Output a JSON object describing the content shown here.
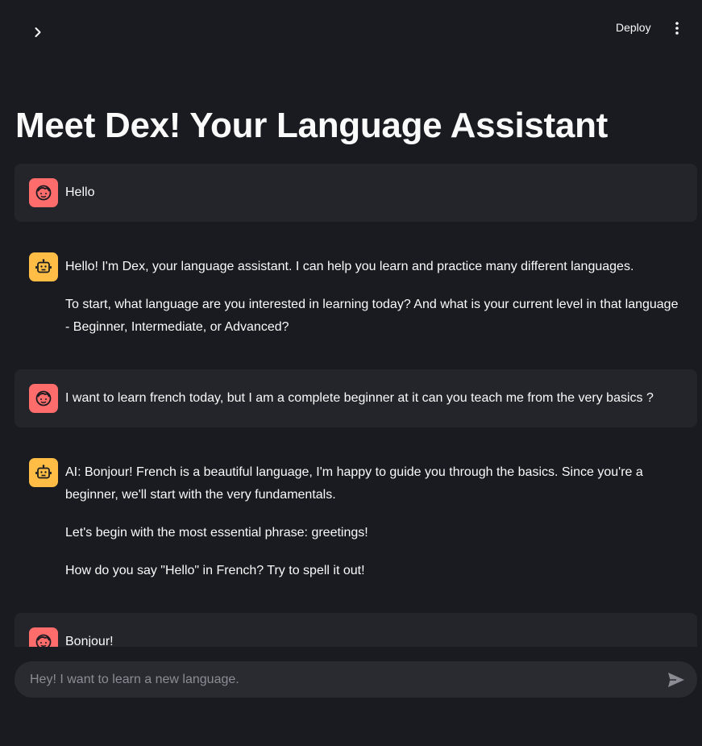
{
  "header": {
    "deploy_label": "Deploy"
  },
  "page": {
    "title": "Meet Dex! Your Language Assistant"
  },
  "messages": [
    {
      "role": "user",
      "paragraphs": [
        "Hello"
      ]
    },
    {
      "role": "assistant",
      "paragraphs": [
        "Hello! I'm Dex, your language assistant. I can help you learn and practice many different languages.",
        "To start, what language are you interested in learning today? And what is your current level in that language - Beginner, Intermediate, or Advanced?"
      ]
    },
    {
      "role": "user",
      "paragraphs": [
        "I want to learn french today, but I am a complete beginner at it can you teach me from the very basics ?"
      ]
    },
    {
      "role": "assistant",
      "paragraphs": [
        "AI: Bonjour! French is a beautiful language, I'm happy to guide you through the basics. Since you're a beginner, we'll start with the very fundamentals.",
        "Let's begin with the most essential phrase: greetings!",
        "How do you say \"Hello\" in French? Try to spell it out!"
      ]
    },
    {
      "role": "user",
      "paragraphs": [
        "Bonjour!"
      ]
    }
  ],
  "chat_input": {
    "placeholder": "Hey! I want to learn a new language."
  },
  "icons": {
    "sidebar_toggle": "chevron-right-icon",
    "menu": "vertical-dots-icon",
    "user_avatar": "face-icon",
    "assistant_avatar": "robot-icon",
    "send": "send-icon"
  },
  "colors": {
    "background": "#1a1b20",
    "user_message_bg": "#24252b",
    "user_avatar": "#ff6c6c",
    "assistant_avatar": "#ffbd45",
    "input_bg": "#2a2b31"
  }
}
